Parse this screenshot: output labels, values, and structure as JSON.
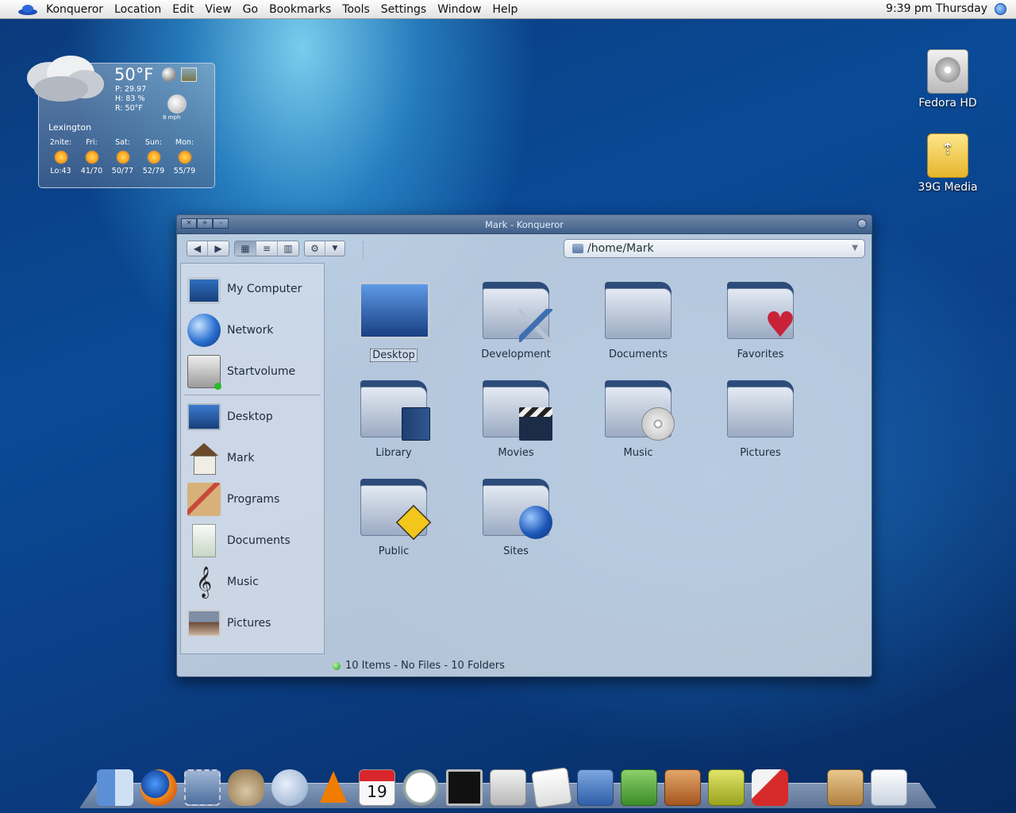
{
  "menubar": {
    "app": "Konqueror",
    "items": [
      "Location",
      "Edit",
      "View",
      "Go",
      "Bookmarks",
      "Tools",
      "Settings",
      "Window",
      "Help"
    ],
    "clock": "9:39 pm Thursday"
  },
  "weather": {
    "temp": "50°F",
    "pressure": "P:  29.97",
    "humidity": "H:  83 %",
    "realfeel": "R:  50°F",
    "wind": "8 mph",
    "city": "Lexington",
    "forecast": [
      {
        "day": "2nite:",
        "temps": "Lo:43"
      },
      {
        "day": "Fri:",
        "temps": "41/70"
      },
      {
        "day": "Sat:",
        "temps": "50/77"
      },
      {
        "day": "Sun:",
        "temps": "52/79"
      },
      {
        "day": "Mon:",
        "temps": "55/79"
      }
    ]
  },
  "desktop_icons": [
    "Fedora HD",
    "39G Media"
  ],
  "window": {
    "title": "Mark - Konqueror",
    "titlebar_buttons": [
      "×",
      "+",
      "–"
    ],
    "toolbar": {
      "back": "◀",
      "forward": "▶",
      "icon_view": "▦",
      "list_view": "≡",
      "column_view": "▥",
      "settings": "⚙",
      "settings_menu": "▼"
    },
    "location": "/home/Mark",
    "location_arrow": "▼",
    "sidebar": {
      "devices": [
        "My Computer",
        "Network",
        "Startvolume"
      ],
      "places": [
        "Desktop",
        "Mark",
        "Programs",
        "Documents",
        "Music",
        "Pictures"
      ]
    },
    "music_glyph": "𝄞",
    "items": [
      "Desktop",
      "Development",
      "Documents",
      "Favorites",
      "Library",
      "Movies",
      "Music",
      "Pictures",
      "Public",
      "Sites"
    ],
    "heart_glyph": "♥",
    "status": "10 Items - No Files - 10 Folders"
  },
  "dock": {
    "calendar_day": "19",
    "items": [
      "finder",
      "firefox",
      "mail",
      "gimp",
      "itunes",
      "vlc",
      "ical",
      "clock",
      "terminal",
      "tux",
      "document",
      "writer",
      "calc",
      "impress",
      "draw",
      "game",
      "trash",
      "windows"
    ]
  }
}
